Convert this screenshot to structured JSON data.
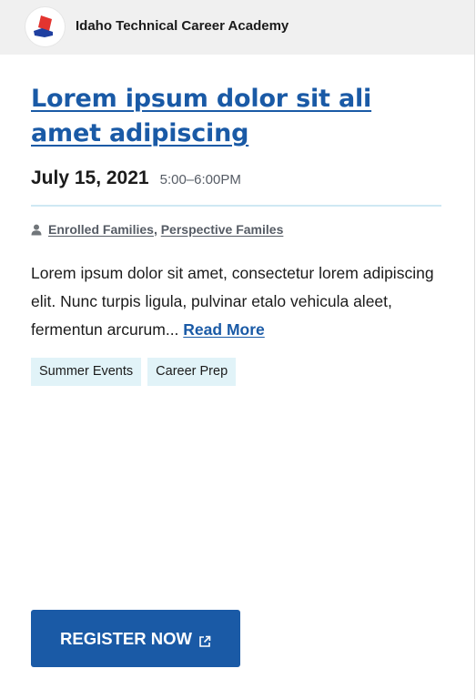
{
  "org": {
    "name": "Idaho Technical Career Academy",
    "logo_icon": "academy-logo-icon"
  },
  "event": {
    "title": "Lorem ipsum dolor sit ali amet adipiscing",
    "date": "July 15, 2021",
    "time": "5:00–6:00PM",
    "audience": [
      "Enrolled Families",
      "Perspective Familes"
    ],
    "audience_separator": ",",
    "description": "Lorem ipsum dolor sit amet, consectetur lorem adipiscing elit. Nunc turpis ligula, pulvinar etalo vehicula aleet, fermentun arcurum...",
    "read_more_label": "Read More",
    "tags": [
      "Summer Events",
      "Career Prep"
    ]
  },
  "register": {
    "label": "REGISTER NOW",
    "icon": "external-link-icon"
  },
  "colors": {
    "primary": "#1a5aa6",
    "header_bg": "#f0f0f0",
    "tag_bg": "#e1f3f8",
    "divider": "#cfe8f3",
    "logo_red": "#e3342f",
    "logo_blue": "#1f3fa0"
  }
}
